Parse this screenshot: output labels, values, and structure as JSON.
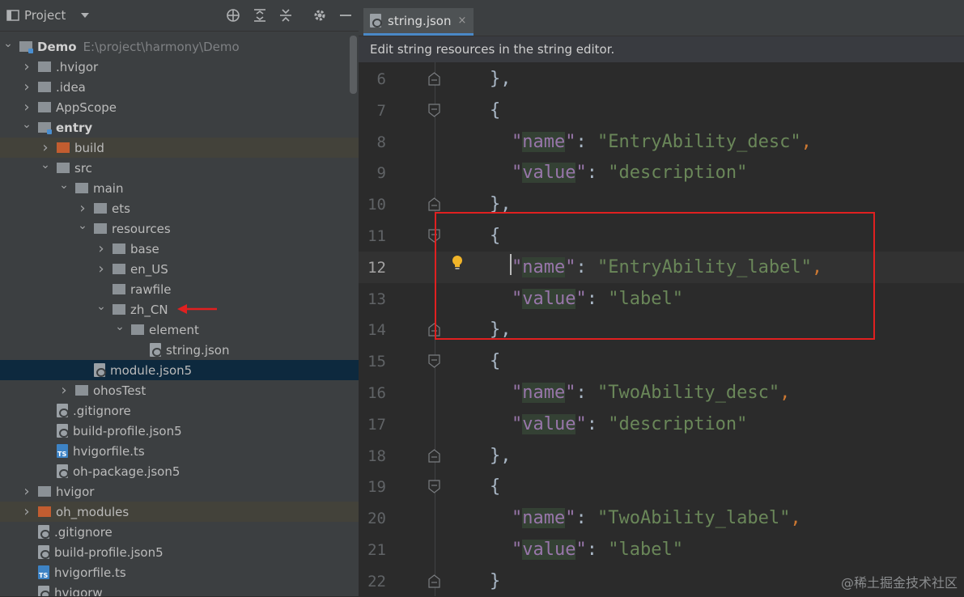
{
  "panel": {
    "title": "Project",
    "icons": [
      "dropdown-caret-icon",
      "locate-icon",
      "expand-all-icon",
      "collapse-all-icon",
      "settings-icon",
      "minimize-icon"
    ]
  },
  "tree": [
    {
      "name": "Demo",
      "path": "E:\\project\\harmony\\Demo",
      "indent": 0,
      "chevron": "open",
      "icon": "module",
      "bold": true
    },
    {
      "name": ".hvigor",
      "indent": 1,
      "chevron": "closed",
      "icon": "folder"
    },
    {
      "name": ".idea",
      "indent": 1,
      "chevron": "closed",
      "icon": "folder"
    },
    {
      "name": "AppScope",
      "indent": 1,
      "chevron": "closed",
      "icon": "folder"
    },
    {
      "name": "entry",
      "indent": 1,
      "chevron": "open",
      "icon": "module",
      "bold": true
    },
    {
      "name": "build",
      "indent": 2,
      "chevron": "closed",
      "icon": "folder-orange",
      "highlight": "yellow"
    },
    {
      "name": "src",
      "indent": 2,
      "chevron": "open",
      "icon": "folder"
    },
    {
      "name": "main",
      "indent": 3,
      "chevron": "open",
      "icon": "folder"
    },
    {
      "name": "ets",
      "indent": 4,
      "chevron": "closed",
      "icon": "folder"
    },
    {
      "name": "resources",
      "indent": 4,
      "chevron": "open",
      "icon": "folder"
    },
    {
      "name": "base",
      "indent": 5,
      "chevron": "closed",
      "icon": "folder"
    },
    {
      "name": "en_US",
      "indent": 5,
      "chevron": "closed",
      "icon": "folder"
    },
    {
      "name": "rawfile",
      "indent": 5,
      "chevron": "none",
      "icon": "folder"
    },
    {
      "name": "zh_CN",
      "indent": 5,
      "chevron": "open",
      "icon": "folder"
    },
    {
      "name": "element",
      "indent": 6,
      "chevron": "open",
      "icon": "folder"
    },
    {
      "name": "string.json",
      "indent": 7,
      "chevron": "none",
      "icon": "json-file"
    },
    {
      "name": "module.json5",
      "indent": 4,
      "chevron": "none",
      "icon": "json-file",
      "highlight": "selected"
    },
    {
      "name": "ohosTest",
      "indent": 3,
      "chevron": "closed",
      "icon": "folder"
    },
    {
      "name": ".gitignore",
      "indent": 2,
      "chevron": "none",
      "icon": "gitignore-file"
    },
    {
      "name": "build-profile.json5",
      "indent": 2,
      "chevron": "none",
      "icon": "json-file"
    },
    {
      "name": "hvigorfile.ts",
      "indent": 2,
      "chevron": "none",
      "icon": "ts-file"
    },
    {
      "name": "oh-package.json5",
      "indent": 2,
      "chevron": "none",
      "icon": "json-file"
    },
    {
      "name": "hvigor",
      "indent": 1,
      "chevron": "closed",
      "icon": "folder"
    },
    {
      "name": "oh_modules",
      "indent": 1,
      "chevron": "closed",
      "icon": "folder-orange",
      "highlight": "yellow"
    },
    {
      "name": ".gitignore",
      "indent": 1,
      "chevron": "none",
      "icon": "gitignore-file"
    },
    {
      "name": "build-profile.json5",
      "indent": 1,
      "chevron": "none",
      "icon": "json-file"
    },
    {
      "name": "hvigorfile.ts",
      "indent": 1,
      "chevron": "none",
      "icon": "ts-file"
    },
    {
      "name": "hvigorw",
      "indent": 1,
      "chevron": "none",
      "icon": "file"
    }
  ],
  "editor": {
    "tab_label": "string.json",
    "tab_close": "×",
    "banner": "Edit string resources in the string editor.",
    "current_line": 12,
    "lines": [
      {
        "n": "6",
        "indent": 0,
        "tokens": [
          [
            "p",
            "},"
          ]
        ],
        "fold": "end"
      },
      {
        "n": "7",
        "indent": 0,
        "tokens": [
          [
            "p",
            "{"
          ]
        ],
        "fold": "start"
      },
      {
        "n": "8",
        "indent": 1,
        "tokens": [
          [
            "k",
            "\"name\""
          ],
          [
            "p",
            ": "
          ],
          [
            "s",
            "\"EntryAbility_desc\""
          ],
          [
            "c",
            ","
          ]
        ]
      },
      {
        "n": "9",
        "indent": 1,
        "tokens": [
          [
            "k",
            "\"value\""
          ],
          [
            "p",
            ": "
          ],
          [
            "s",
            "\"description\""
          ]
        ]
      },
      {
        "n": "10",
        "indent": 0,
        "tokens": [
          [
            "p",
            "},"
          ]
        ],
        "fold": "end"
      },
      {
        "n": "11",
        "indent": 0,
        "tokens": [
          [
            "p",
            "{"
          ]
        ],
        "fold": "start"
      },
      {
        "n": "12",
        "indent": 1,
        "tokens": [
          [
            "k",
            "\"name\""
          ],
          [
            "p",
            ": "
          ],
          [
            "s",
            "\"EntryAbility_label\""
          ],
          [
            "c",
            ","
          ]
        ]
      },
      {
        "n": "13",
        "indent": 1,
        "tokens": [
          [
            "k",
            "\"value\""
          ],
          [
            "p",
            ": "
          ],
          [
            "s",
            "\"label\""
          ]
        ]
      },
      {
        "n": "14",
        "indent": 0,
        "tokens": [
          [
            "p",
            "},"
          ]
        ],
        "fold": "end"
      },
      {
        "n": "15",
        "indent": 0,
        "tokens": [
          [
            "p",
            "{"
          ]
        ],
        "fold": "start"
      },
      {
        "n": "16",
        "indent": 1,
        "tokens": [
          [
            "k",
            "\"name\""
          ],
          [
            "p",
            ": "
          ],
          [
            "s",
            "\"TwoAbility_desc\""
          ],
          [
            "c",
            ","
          ]
        ]
      },
      {
        "n": "17",
        "indent": 1,
        "tokens": [
          [
            "k",
            "\"value\""
          ],
          [
            "p",
            ": "
          ],
          [
            "s",
            "\"description\""
          ]
        ]
      },
      {
        "n": "18",
        "indent": 0,
        "tokens": [
          [
            "p",
            "},"
          ]
        ],
        "fold": "end"
      },
      {
        "n": "19",
        "indent": 0,
        "tokens": [
          [
            "p",
            "{"
          ]
        ],
        "fold": "start"
      },
      {
        "n": "20",
        "indent": 1,
        "tokens": [
          [
            "k",
            "\"name\""
          ],
          [
            "p",
            ": "
          ],
          [
            "s",
            "\"TwoAbility_label\""
          ],
          [
            "c",
            ","
          ]
        ]
      },
      {
        "n": "21",
        "indent": 1,
        "tokens": [
          [
            "k",
            "\"value\""
          ],
          [
            "p",
            ": "
          ],
          [
            "s",
            "\"label\""
          ]
        ]
      },
      {
        "n": "22",
        "indent": 0,
        "tokens": [
          [
            "p",
            "}"
          ]
        ],
        "fold": "end"
      }
    ]
  },
  "watermark": "@稀土掘金技术社区",
  "colors": {
    "panel_bg": "#3c3f41",
    "editor_bg": "#2b2b2b",
    "selection": "#0d293e",
    "highlight": "#43423a",
    "json_key": "#9876aa",
    "json_string": "#6a8759",
    "punct": "#cc7832",
    "annotation_red": "#e02020"
  }
}
